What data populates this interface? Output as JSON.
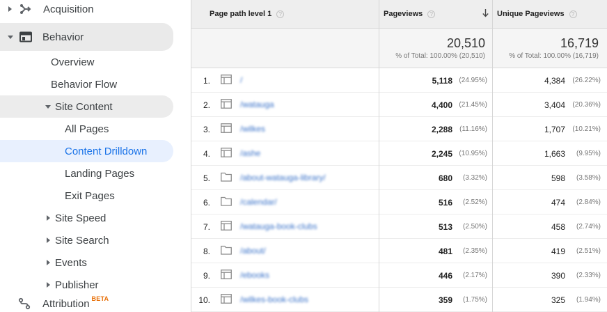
{
  "sidebar": {
    "acquisition": "Acquisition",
    "behavior": "Behavior",
    "overview": "Overview",
    "behavior_flow": "Behavior Flow",
    "site_content": "Site Content",
    "all_pages": "All Pages",
    "content_drilldown": "Content Drilldown",
    "landing_pages": "Landing Pages",
    "exit_pages": "Exit Pages",
    "site_speed": "Site Speed",
    "site_search": "Site Search",
    "events": "Events",
    "publisher": "Publisher",
    "attribution": "Attribution",
    "attribution_badge": "BETA"
  },
  "table": {
    "headers": {
      "dimension": "Page path level 1",
      "pageviews": "Pageviews",
      "unique_pageviews": "Unique Pageviews"
    },
    "totals": {
      "pageviews": "20,510",
      "pageviews_pct": "% of Total: 100.00% (20,510)",
      "unique_pageviews": "16,719",
      "unique_pageviews_pct": "% of Total: 100.00% (16,719)"
    },
    "rows": [
      {
        "index": "1.",
        "icon": "table-icon",
        "path": "/",
        "pageviews": "5,118",
        "pageviews_pct": "(24.95%)",
        "unique": "4,384",
        "unique_pct": "(26.22%)"
      },
      {
        "index": "2.",
        "icon": "table-icon",
        "path": "/watauga",
        "pageviews": "4,400",
        "pageviews_pct": "(21.45%)",
        "unique": "3,404",
        "unique_pct": "(20.36%)"
      },
      {
        "index": "3.",
        "icon": "table-icon",
        "path": "/wilkes",
        "pageviews": "2,288",
        "pageviews_pct": "(11.16%)",
        "unique": "1,707",
        "unique_pct": "(10.21%)"
      },
      {
        "index": "4.",
        "icon": "table-icon",
        "path": "/ashe",
        "pageviews": "2,245",
        "pageviews_pct": "(10.95%)",
        "unique": "1,663",
        "unique_pct": "(9.95%)"
      },
      {
        "index": "5.",
        "icon": "folder-icon",
        "path": "/about-watauga-library/",
        "pageviews": "680",
        "pageviews_pct": "(3.32%)",
        "unique": "598",
        "unique_pct": "(3.58%)"
      },
      {
        "index": "6.",
        "icon": "folder-icon",
        "path": "/calendar/",
        "pageviews": "516",
        "pageviews_pct": "(2.52%)",
        "unique": "474",
        "unique_pct": "(2.84%)"
      },
      {
        "index": "7.",
        "icon": "table-icon",
        "path": "/watauga-book-clubs",
        "pageviews": "513",
        "pageviews_pct": "(2.50%)",
        "unique": "458",
        "unique_pct": "(2.74%)"
      },
      {
        "index": "8.",
        "icon": "folder-icon",
        "path": "/about/",
        "pageviews": "481",
        "pageviews_pct": "(2.35%)",
        "unique": "419",
        "unique_pct": "(2.51%)"
      },
      {
        "index": "9.",
        "icon": "table-icon",
        "path": "/ebooks",
        "pageviews": "446",
        "pageviews_pct": "(2.17%)",
        "unique": "390",
        "unique_pct": "(2.33%)"
      },
      {
        "index": "10.",
        "icon": "table-icon",
        "path": "/wilkes-book-clubs",
        "pageviews": "359",
        "pageviews_pct": "(1.75%)",
        "unique": "325",
        "unique_pct": "(1.94%)"
      }
    ]
  }
}
